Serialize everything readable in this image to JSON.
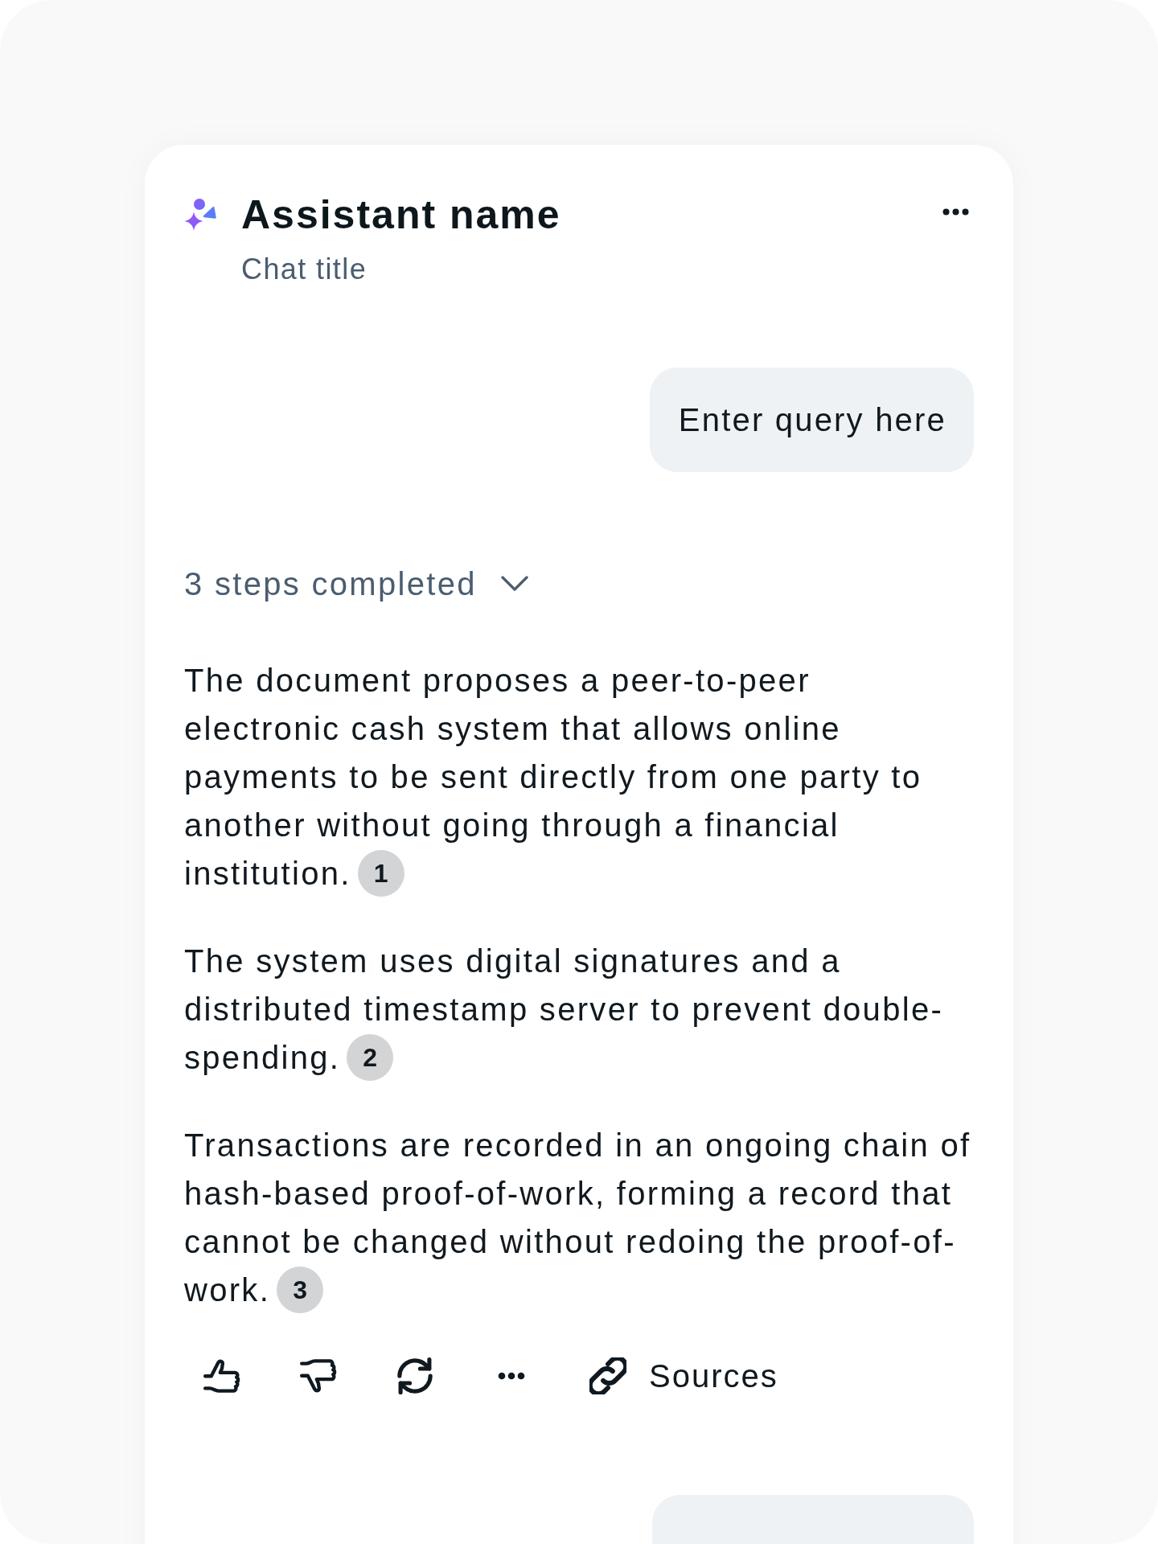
{
  "header": {
    "assistant_name": "Assistant name",
    "chat_title": "Chat title"
  },
  "messages": [
    {
      "kind": "user",
      "text": "Enter query here"
    },
    {
      "kind": "assistant",
      "steps": {
        "label": "3 steps completed",
        "expanded": false
      },
      "paragraphs": [
        {
          "text": "The document proposes a peer-to-peer electronic cash system that allows online payments to be sent directly from one party to another without going through a financial institution.",
          "citation": "1"
        },
        {
          "text": "The system uses digital signatures and a distributed timestamp server to prevent double-spending.",
          "citation": "2"
        },
        {
          "text": "Transactions are recorded in an ongoing chain of hash-based proof-of-work, forming a record that cannot be changed without redoing the proof-of-work.",
          "citation": "3"
        }
      ],
      "actions": [
        {
          "kind": "like"
        },
        {
          "kind": "dislike"
        },
        {
          "kind": "regenerate"
        },
        {
          "kind": "more"
        },
        {
          "kind": "sources",
          "label": "Sources"
        }
      ]
    },
    {
      "kind": "user"
    }
  ]
}
